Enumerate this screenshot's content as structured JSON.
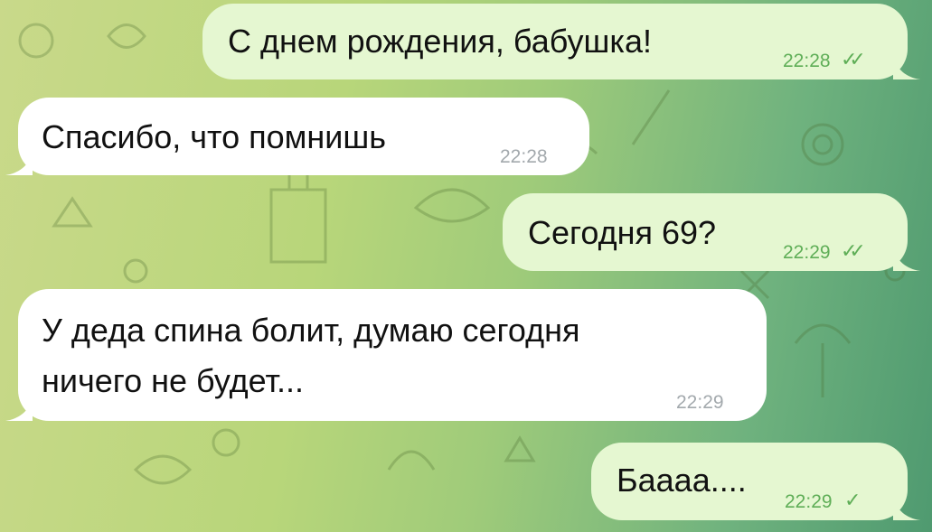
{
  "chat": {
    "colors": {
      "outgoing_bubble": "#e5f7d1",
      "incoming_bubble": "#ffffff",
      "outgoing_meta": "#5fae57",
      "incoming_time": "#a3a9ad"
    },
    "messages": [
      {
        "direction": "outgoing",
        "text": "С днем рождения, бабушка!",
        "time": "22:28",
        "status": "read",
        "check_icon": "double-check-icon",
        "check_glyph": "✓✓"
      },
      {
        "direction": "incoming",
        "text": "Спасибо, что помнишь",
        "time": "22:28"
      },
      {
        "direction": "outgoing",
        "text": "Сегодня 69?",
        "time": "22:29",
        "status": "read",
        "check_icon": "double-check-icon",
        "check_glyph": "✓✓"
      },
      {
        "direction": "incoming",
        "lines": [
          "У деда спина болит, думаю сегодня",
          "ничего не будет..."
        ],
        "time": "22:29"
      },
      {
        "direction": "outgoing",
        "text": "Баааа....",
        "time": "22:29",
        "status": "sent",
        "check_icon": "single-check-icon",
        "check_glyph": "✓"
      }
    ]
  }
}
